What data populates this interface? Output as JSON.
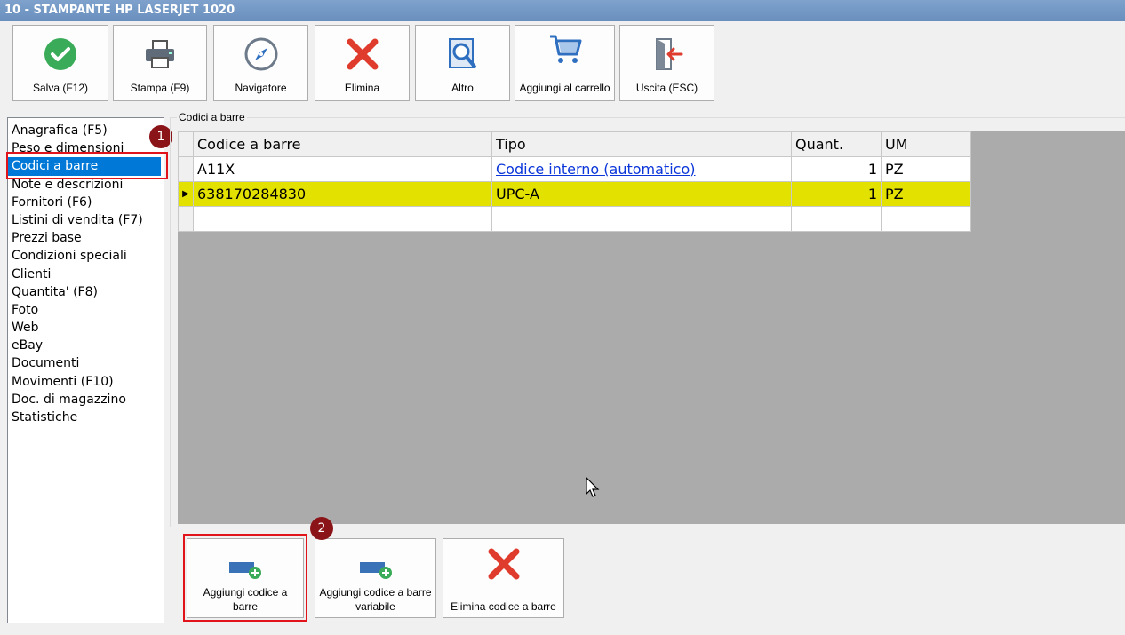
{
  "window": {
    "title": "10 - STAMPANTE HP LASERJET 1020"
  },
  "toolbar": {
    "buttons": [
      {
        "label": "Salva (F12)",
        "icon": "check-icon"
      },
      {
        "label": "Stampa (F9)",
        "icon": "printer-icon"
      },
      {
        "label": "Navigatore",
        "icon": "compass-icon"
      },
      {
        "label": "Elimina",
        "icon": "delete-x-icon"
      },
      {
        "label": "Altro",
        "icon": "magnifier-icon"
      },
      {
        "label": "Aggiungi al carrello",
        "icon": "cart-icon"
      },
      {
        "label": "Uscita (ESC)",
        "icon": "exit-icon"
      }
    ]
  },
  "sidebar": {
    "items": [
      "Anagrafica (F5)",
      "Peso e dimensioni",
      "Codici a barre",
      "Note e descrizioni",
      "Fornitori (F6)",
      "Listini di vendita (F7)",
      "Prezzi base",
      "Condizioni speciali",
      "Clienti",
      "Quantita' (F8)",
      "Foto",
      "Web",
      "eBay",
      "Documenti",
      "Movimenti (F10)",
      "Doc. di magazzino",
      "Statistiche"
    ],
    "selected": "Codici a barre"
  },
  "badges": {
    "one": "1",
    "two": "2"
  },
  "group": {
    "label": "Codici a barre"
  },
  "grid": {
    "columns": [
      "Codice a barre",
      "Tipo",
      "Quant.",
      "UM"
    ],
    "rows": [
      {
        "code": "A11X",
        "tipo": "Codice interno (automatico)",
        "quant": "1",
        "um": "PZ"
      },
      {
        "code": "638170284830",
        "tipo": "UPC-A",
        "quant": "1",
        "um": "PZ"
      }
    ],
    "current_row_marker": "▶"
  },
  "actions": {
    "buttons": [
      {
        "label": "Aggiungi codice a barre",
        "icon": "add-barcode-icon"
      },
      {
        "label": "Aggiungi codice a barre variabile",
        "icon": "add-variable-barcode-icon"
      },
      {
        "label": "Elimina codice a barre",
        "icon": "delete-x-icon"
      }
    ]
  },
  "colors": {
    "title_bar": "#6a8fbe",
    "selection": "#0078d7",
    "highlight_row": "#e3e100",
    "annotation_red": "#e0141a",
    "badge": "#8b1418",
    "link": "#0b36d9"
  }
}
